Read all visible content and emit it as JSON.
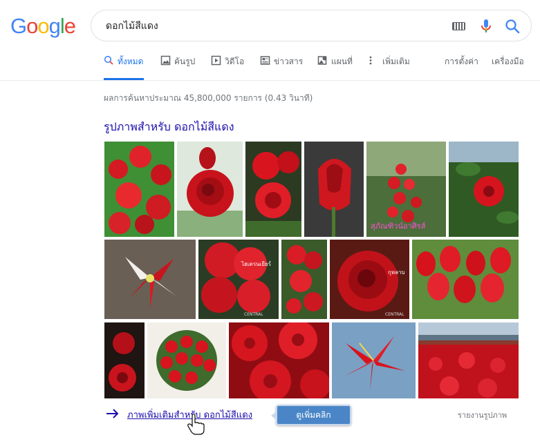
{
  "logo": {
    "letters": [
      "G",
      "o",
      "o",
      "g",
      "l",
      "e"
    ],
    "colors": [
      "#4285f4",
      "#ea4335",
      "#fbbc05",
      "#4285f4",
      "#34a853",
      "#ea4335"
    ]
  },
  "search": {
    "query": "ดอกไม้สีแดง"
  },
  "icons": {
    "keyboard": "keyboard-icon",
    "mic": "mic-icon",
    "search": "search-icon"
  },
  "tabs": [
    {
      "label": "ทั้งหมด",
      "icon": "search-icon",
      "active": true
    },
    {
      "label": "ค้นรูป",
      "icon": "image-icon"
    },
    {
      "label": "วิดีโอ",
      "icon": "video-icon"
    },
    {
      "label": "ข่าวสาร",
      "icon": "news-icon"
    },
    {
      "label": "แผนที่",
      "icon": "map-icon"
    },
    {
      "label": "เพิ่มเติม",
      "icon": "more-vert-icon"
    }
  ],
  "tools": {
    "settings": "การตั้งค่า",
    "tools": "เครื่องมือ"
  },
  "stats": "ผลการค้นหาประมาณ 45,800,000 รายการ (0.43 วินาที)",
  "images_section": {
    "title": "รูปภาพสำหรับ ดอกไม้สีแดง",
    "overlay_texts": [
      "สุภัณฑิวน์อาศิรส์",
      "ไฮเดรนเยียร์",
      "CENTRAL",
      "กุหลาบ",
      "CENTRAL"
    ],
    "more_link": "ภาพเพิ่มเติมสำหรับ ดอกไม้สีแดง",
    "report": "รายงานรูปภาพ"
  },
  "tooltip": "ดูเพิ่มคลิก",
  "accent": "#1a73e8",
  "link_color": "#1a0dab"
}
